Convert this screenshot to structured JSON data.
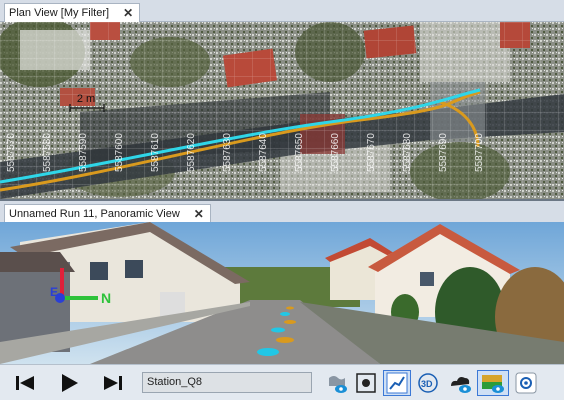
{
  "plan_tab": {
    "title": "Plan View [My Filter]",
    "close": "✕"
  },
  "pano_tab": {
    "title": "Unnamed Run  11, Panoramic View",
    "close": "✕"
  },
  "plan_view": {
    "grid_labels": [
      "5587570",
      "5587580",
      "5587590",
      "5587600",
      "5587610",
      "5587620",
      "5587630",
      "5587640",
      "5587650",
      "5587660",
      "5587670",
      "5587680",
      "5587690",
      "5587700"
    ],
    "scale_label": "2 m"
  },
  "pano_view": {
    "axis_north": "N",
    "axis_east": "E"
  },
  "toolbar": {
    "station_value": "Station_Q8",
    "icons": [
      "skip-back-icon",
      "play-icon",
      "skip-forward-icon",
      "map-eye-icon",
      "focus-icon",
      "trajectory-icon",
      "3d-rotate-icon",
      "cloud-eye-icon",
      "layers-eye-icon",
      "settings-icon"
    ]
  },
  "colors": {
    "trajectory_cyan": "#2fd6e8",
    "trajectory_orange": "#d99a1e",
    "accent": "#3b78d6"
  }
}
